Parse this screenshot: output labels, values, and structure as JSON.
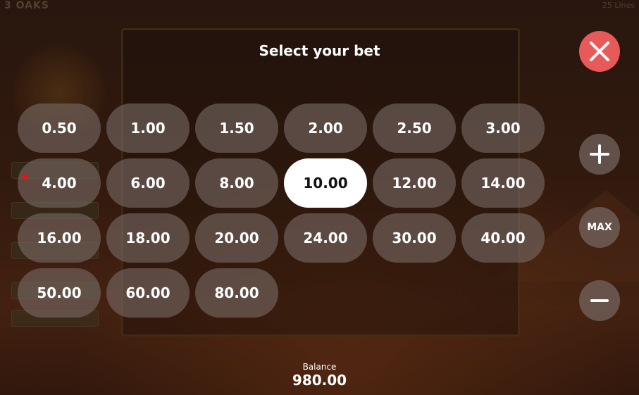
{
  "game": {
    "title": "3 OAKS",
    "lines": "25 Lines"
  },
  "dialog": {
    "title": "Select your bet",
    "bets": [
      {
        "label": "0.50",
        "selected": false
      },
      {
        "label": "1.00",
        "selected": false
      },
      {
        "label": "1.50",
        "selected": false
      },
      {
        "label": "2.00",
        "selected": false
      },
      {
        "label": "2.50",
        "selected": false
      },
      {
        "label": "3.00",
        "selected": false
      },
      {
        "label": "4.00",
        "selected": false
      },
      {
        "label": "6.00",
        "selected": false
      },
      {
        "label": "8.00",
        "selected": false
      },
      {
        "label": "10.00",
        "selected": true
      },
      {
        "label": "12.00",
        "selected": false
      },
      {
        "label": "14.00",
        "selected": false
      },
      {
        "label": "16.00",
        "selected": false
      },
      {
        "label": "18.00",
        "selected": false
      },
      {
        "label": "20.00",
        "selected": false
      },
      {
        "label": "24.00",
        "selected": false
      },
      {
        "label": "30.00",
        "selected": false
      },
      {
        "label": "40.00",
        "selected": false
      },
      {
        "label": "50.00",
        "selected": false
      },
      {
        "label": "60.00",
        "selected": false
      },
      {
        "label": "80.00",
        "selected": false
      }
    ],
    "controls": {
      "close_icon": "close-icon",
      "plus_icon": "plus-icon",
      "max_label": "MAX",
      "minus_icon": "minus-icon"
    }
  },
  "balance": {
    "label": "Balance",
    "value": "980.00"
  },
  "colors": {
    "close_button": "#e85a5a",
    "selected_bet_bg": "#ffffff",
    "bet_button_bg": "#786964",
    "indicator_dot": "#e01818"
  }
}
